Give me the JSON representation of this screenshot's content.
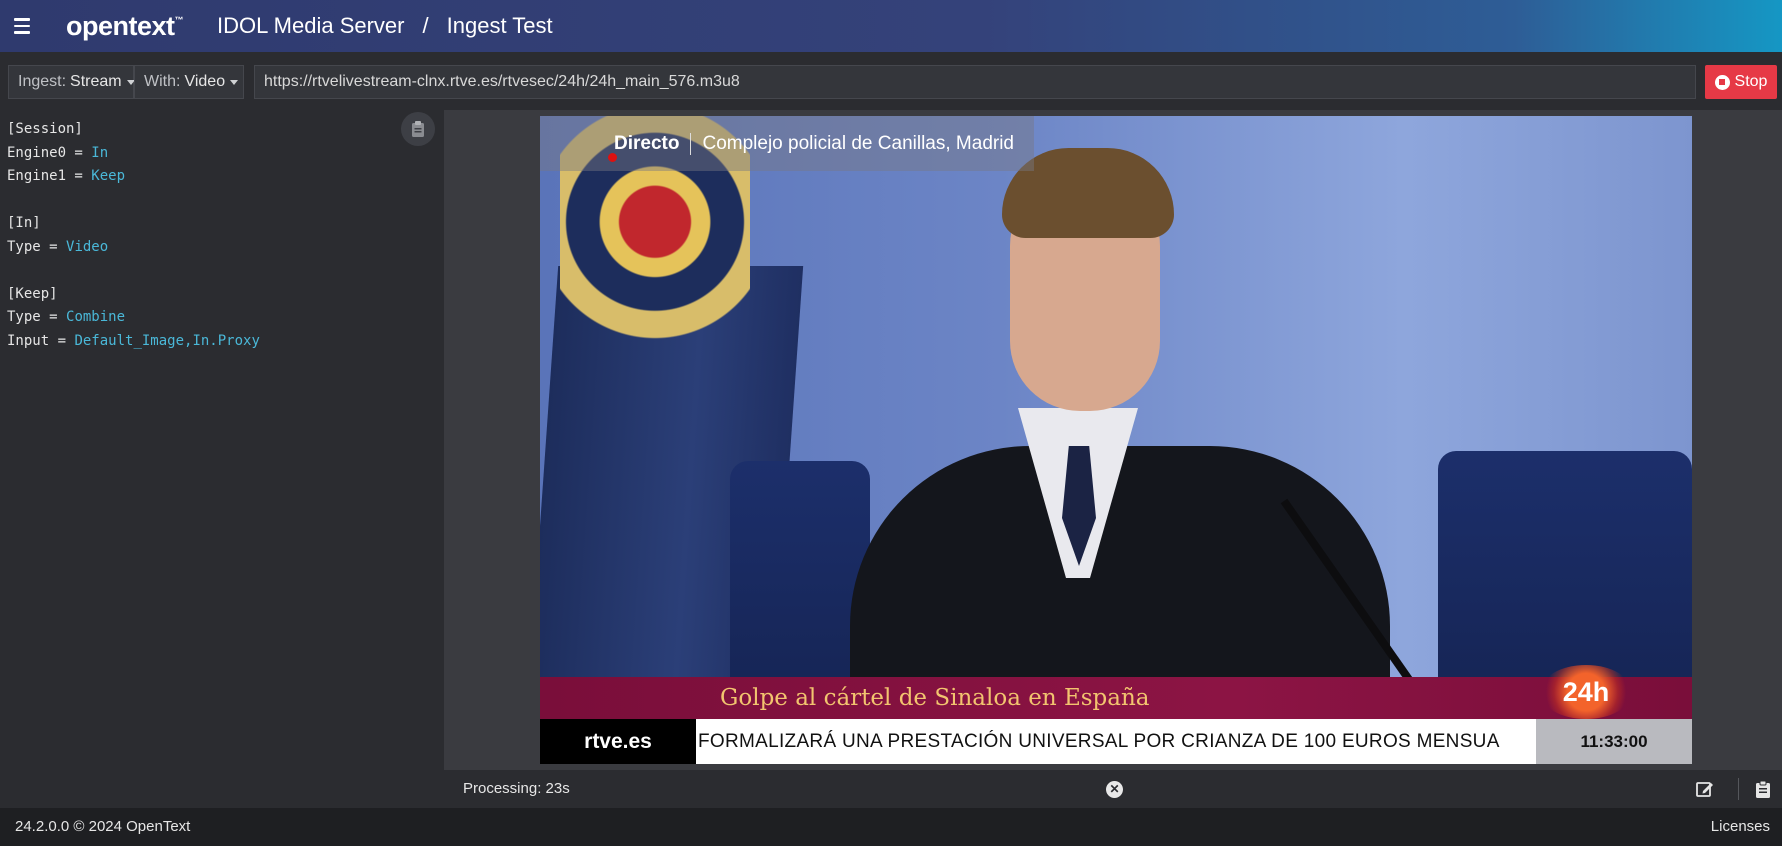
{
  "header": {
    "logo": "opentext",
    "logo_tm": "™",
    "product": "IDOL Media Server",
    "separator": "/",
    "page": "Ingest Test"
  },
  "toolbar": {
    "ingest_label": "Ingest:",
    "ingest_value": "Stream",
    "with_label": "With:",
    "with_value": "Video",
    "url": "https://rtvelivestream-clnx.rtve.es/rtvesec/24h/24h_main_576.m3u8",
    "stop_label": "Stop"
  },
  "config": {
    "lines": [
      {
        "key": "[Session]",
        "value": ""
      },
      {
        "key": "Engine0 = ",
        "value": "In"
      },
      {
        "key": "Engine1 = ",
        "value": "Keep"
      },
      {
        "key": "",
        "value": ""
      },
      {
        "key": "[In]",
        "value": ""
      },
      {
        "key": "Type = ",
        "value": "Video"
      },
      {
        "key": "",
        "value": ""
      },
      {
        "key": "[Keep]",
        "value": ""
      },
      {
        "key": "Type = ",
        "value": "Combine"
      },
      {
        "key": "Input = ",
        "value": "Default_Image,In.Proxy"
      }
    ]
  },
  "video": {
    "live_label": "Directo",
    "live_location": "Complejo policial de Canillas, Madrid",
    "headline": "Golpe al cártel de Sinaloa en España",
    "channel_tag": "24h",
    "ticker_logo": "rtve.es",
    "ticker_text": "FORMALIZARÁ UNA PRESTACIÓN UNIVERSAL POR CRIANZA DE 100 EUROS MENSUA",
    "ticker_time": "11:33:00"
  },
  "status": {
    "processing": "Processing: 23s"
  },
  "footer": {
    "version": "24.2.0.0 © 2024 OpenText",
    "licenses": "Licenses"
  },
  "colors": {
    "accent": "#4ab8d8",
    "stop": "#e63946"
  }
}
